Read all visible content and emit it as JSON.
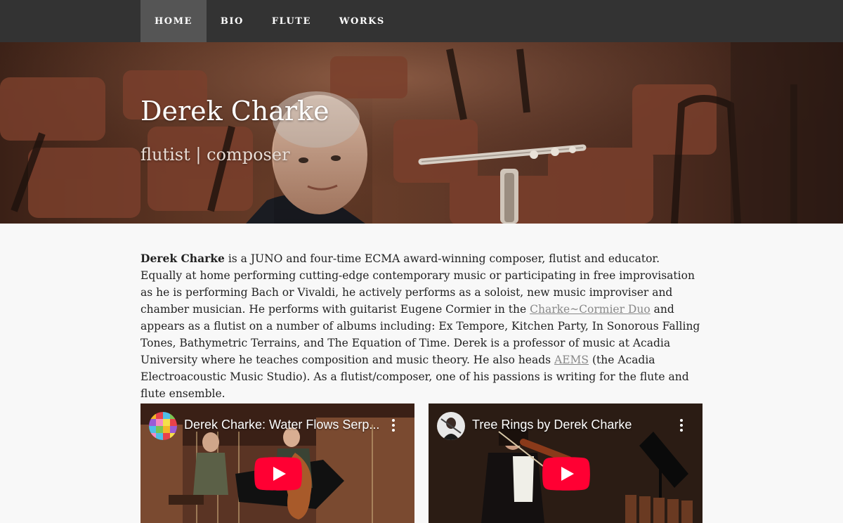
{
  "nav": {
    "items": [
      {
        "label": "HOME",
        "active": true
      },
      {
        "label": "BIO",
        "active": false
      },
      {
        "label": "FLUTE",
        "active": false
      },
      {
        "label": "WORKS",
        "active": false
      }
    ]
  },
  "hero": {
    "title": "Derek Charke",
    "subtitle": "flutist | composer"
  },
  "bio": {
    "name": "Derek Charke",
    "text_1": " is a JUNO and four-time ECMA award-winning composer, flutist and educator. Equally at home performing cutting-edge contemporary music or participating in free improvisation as he is performing Bach or Vivaldi, he actively performs as a soloist, new music improviser and chamber musician. He performs with guitarist Eugene Cormier in the ",
    "link_duo": "Charke~Cormier Duo",
    "text_2": " and appears as a flutist on a number of albums including: Ex Tempore, Kitchen Party, In Sonorous Falling Tones, Bathymetric Terrains, and The Equation of Time. Derek is a professor of music at Acadia University where he teaches composition and music theory. He also heads ",
    "link_aems": "AEMS",
    "text_3": " (the Acadia Electroacoustic Music Studio). As a flutist/composer, one of his passions is writing for the flute and flute ensemble."
  },
  "videos": [
    {
      "title": "Derek Charke: Water Flows Serp...",
      "avatar_icon": "colorful-grid-avatar-icon"
    },
    {
      "title": "Tree Rings by Derek Charke",
      "avatar_icon": "violinist-avatar-icon"
    }
  ],
  "colors": {
    "nav_bg": "#333333",
    "nav_active": "#555555",
    "page_bg": "#f8f8f8",
    "link": "#888888",
    "youtube_red": "#ff0000"
  }
}
